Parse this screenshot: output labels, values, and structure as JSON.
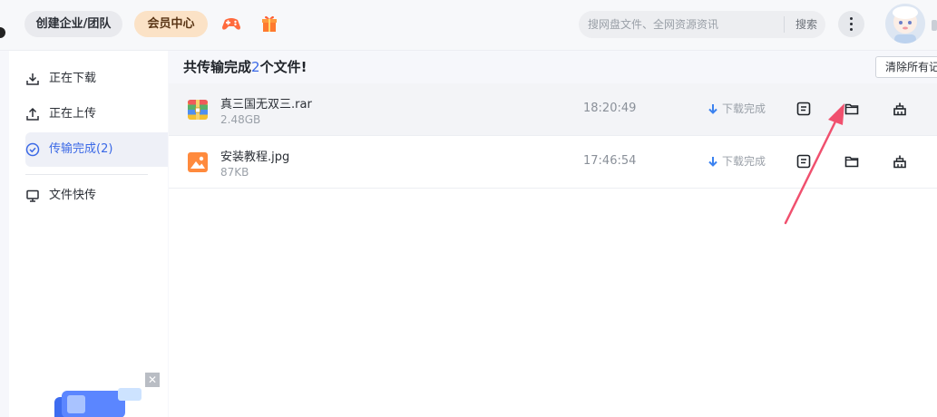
{
  "header": {
    "enterprise_label": "创建企业/团队",
    "member_label": "会员中心",
    "search": {
      "placeholder": "搜网盘文件、全网资源资讯",
      "button_label": "搜索"
    }
  },
  "sidebar": {
    "items": [
      {
        "label": "正在下载",
        "icon": "download-icon"
      },
      {
        "label": "正在上传",
        "icon": "upload-icon"
      },
      {
        "label": "传输完成(2)",
        "icon": "check-circle-icon",
        "active": true
      },
      {
        "label": "文件快传",
        "icon": "monitor-icon"
      }
    ],
    "promo_close": "✕"
  },
  "main": {
    "summary_prefix": "共传输完成",
    "summary_count": "2",
    "summary_suffix": "个文件!",
    "clear_label": "清除所有记录",
    "files": [
      {
        "name": "真三国无双三.rar",
        "size": "2.48GB",
        "time": "18:20:49",
        "status": "下载完成",
        "type": "archive"
      },
      {
        "name": "安装教程.jpg",
        "size": "87KB",
        "time": "17:46:54",
        "status": "下载完成",
        "type": "image"
      }
    ]
  },
  "colors": {
    "accent": "#3b69e6",
    "member_bg": "#fbe2c6",
    "annotation_arrow": "#f0506e"
  }
}
